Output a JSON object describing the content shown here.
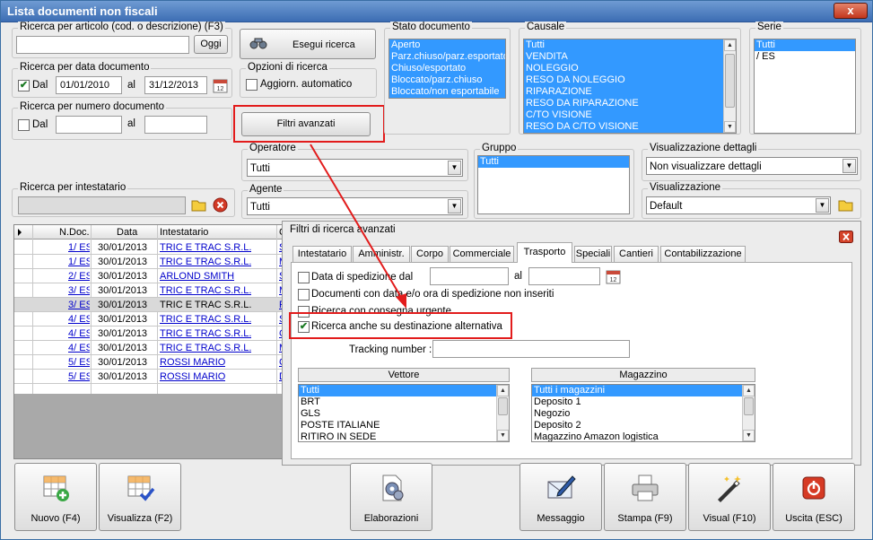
{
  "window": {
    "title": "Lista documenti non fiscali",
    "close_label": "x"
  },
  "search_article": {
    "label": "Ricerca per articolo (cod. o descrizione) (F3)",
    "value": "",
    "button": "Oggi"
  },
  "exec_search": {
    "label": "Esegui ricerca"
  },
  "search_date": {
    "label": "Ricerca per data documento",
    "checkbox_label": "Dal",
    "checked": true,
    "from": "01/01/2010",
    "to_label": "al",
    "to": "31/12/2013"
  },
  "search_options": {
    "label": "Opzioni di ricerca",
    "auto_update": "Aggiorn. automatico"
  },
  "search_number": {
    "label": "Ricerca per numero documento",
    "checkbox_label": "Dal",
    "to_label": "al",
    "from": "",
    "to": ""
  },
  "advanced_button": {
    "label": "Filtri avanzati"
  },
  "doc_state": {
    "label": "Stato documento",
    "items": [
      "Aperto",
      "Parz.chiuso/parz.esportato",
      "Chiuso/esportato",
      "Bloccato/parz.chiuso",
      "Bloccato/non esportabile"
    ]
  },
  "causale": {
    "label": "Causale",
    "items": [
      "Tutti",
      "VENDITA",
      "NOLEGGIO",
      "RESO DA NOLEGGIO",
      "RIPARAZIONE",
      "RESO DA RIPARAZIONE",
      "C/TO VISIONE",
      "RESO DA C/TO VISIONE"
    ]
  },
  "serie": {
    "label": "Serie",
    "items": [
      "Tutti",
      "/ ES"
    ]
  },
  "operatore": {
    "label": "Operatore",
    "value": "Tutti"
  },
  "gruppo": {
    "label": "Gruppo",
    "items": [
      "Tutti"
    ]
  },
  "visual_dettagli": {
    "label": "Visualizzazione dettagli",
    "value": "Non visualizzare dettagli"
  },
  "search_holder": {
    "label": "Ricerca per intestatario",
    "value": ""
  },
  "agente": {
    "label": "Agente",
    "value": "Tutti"
  },
  "visualizzazione": {
    "label": "Visualizzazione",
    "value": "Default"
  },
  "grid": {
    "headers": [
      "N.Doc.",
      "Data",
      "Intestatario",
      "C"
    ],
    "rows": [
      {
        "num": "1/ ES",
        "date": "30/01/2013",
        "holder": "TRIC E TRAC S.R.L.",
        "c": "S"
      },
      {
        "num": "1/ ES",
        "date": "30/01/2013",
        "holder": "TRIC E TRAC S.R.L.",
        "c": "M"
      },
      {
        "num": "2/ ES",
        "date": "30/01/2013",
        "holder": "ARLOND SMITH",
        "c": "S"
      },
      {
        "num": "3/ ES",
        "date": "30/01/2013",
        "holder": "TRIC E TRAC S.R.L.",
        "c": "M"
      },
      {
        "num": "3/ ES",
        "date": "30/01/2013",
        "holder": "TRIC E TRAC S.R.L.",
        "c": "F"
      },
      {
        "num": "4/ ES",
        "date": "30/01/2013",
        "holder": "TRIC E TRAC S.R.L.",
        "c": "S"
      },
      {
        "num": "4/ ES",
        "date": "30/01/2013",
        "holder": "TRIC E TRAC S.R.L.",
        "c": "C"
      },
      {
        "num": "4/ ES",
        "date": "30/01/2013",
        "holder": "TRIC E TRAC S.R.L.",
        "c": "M"
      },
      {
        "num": "5/ ES",
        "date": "30/01/2013",
        "holder": "ROSSI MARIO",
        "c": "C"
      },
      {
        "num": "5/ ES",
        "date": "30/01/2013",
        "holder": "ROSSI MARIO",
        "c": "D"
      }
    ]
  },
  "advanced": {
    "title": "Filtri di ricerca avanzati",
    "tabs": [
      "Intestatario",
      "Amministr.",
      "Corpo",
      "Commerciale",
      "Trasporto",
      "Speciali",
      "Cantieri",
      "Contabilizzazione"
    ],
    "active_tab": "Trasporto",
    "ship_date_label": "Data di spedizione dal",
    "ship_date_to_label": "al",
    "ship_date_from": "",
    "ship_date_to": "",
    "no_ship_date_label": "Documenti con data e/o ora di spedizione non inseriti",
    "urgent_label": "Ricerca con consegna urgente",
    "alt_dest_label": "Ricerca anche su destinazione alternativa",
    "alt_dest_checked": true,
    "tracking_label": "Tracking number :",
    "tracking_value": "",
    "vettore": {
      "label": "Vettore",
      "items": [
        "Tutti",
        "BRT",
        "GLS",
        "POSTE ITALIANE",
        "RITIRO IN SEDE"
      ]
    },
    "magazzino": {
      "label": "Magazzino",
      "items": [
        "Tutti i magazzini",
        "Deposito 1",
        "Negozio",
        "Deposito 2",
        "Magazzino Amazon logistica"
      ]
    }
  },
  "bottom_buttons": {
    "new": "Nuovo (F4)",
    "view": "Visualizza (F2)",
    "process": "Elaborazioni",
    "message": "Messaggio",
    "print": "Stampa (F9)",
    "visual": "Visual (F10)",
    "exit": "Uscita (ESC)"
  },
  "colors": {
    "accent": "#3399ff",
    "highlight": "#e21c1c",
    "title_bar": "#4a7cc0"
  },
  "icons": [
    "binoculars-icon",
    "calendar-icon",
    "folder-icon",
    "delete-icon",
    "grid-add-icon",
    "grid-check-icon",
    "gears-icon",
    "envelope-pen-icon",
    "printer-icon",
    "magic-wand-icon",
    "power-icon"
  ]
}
